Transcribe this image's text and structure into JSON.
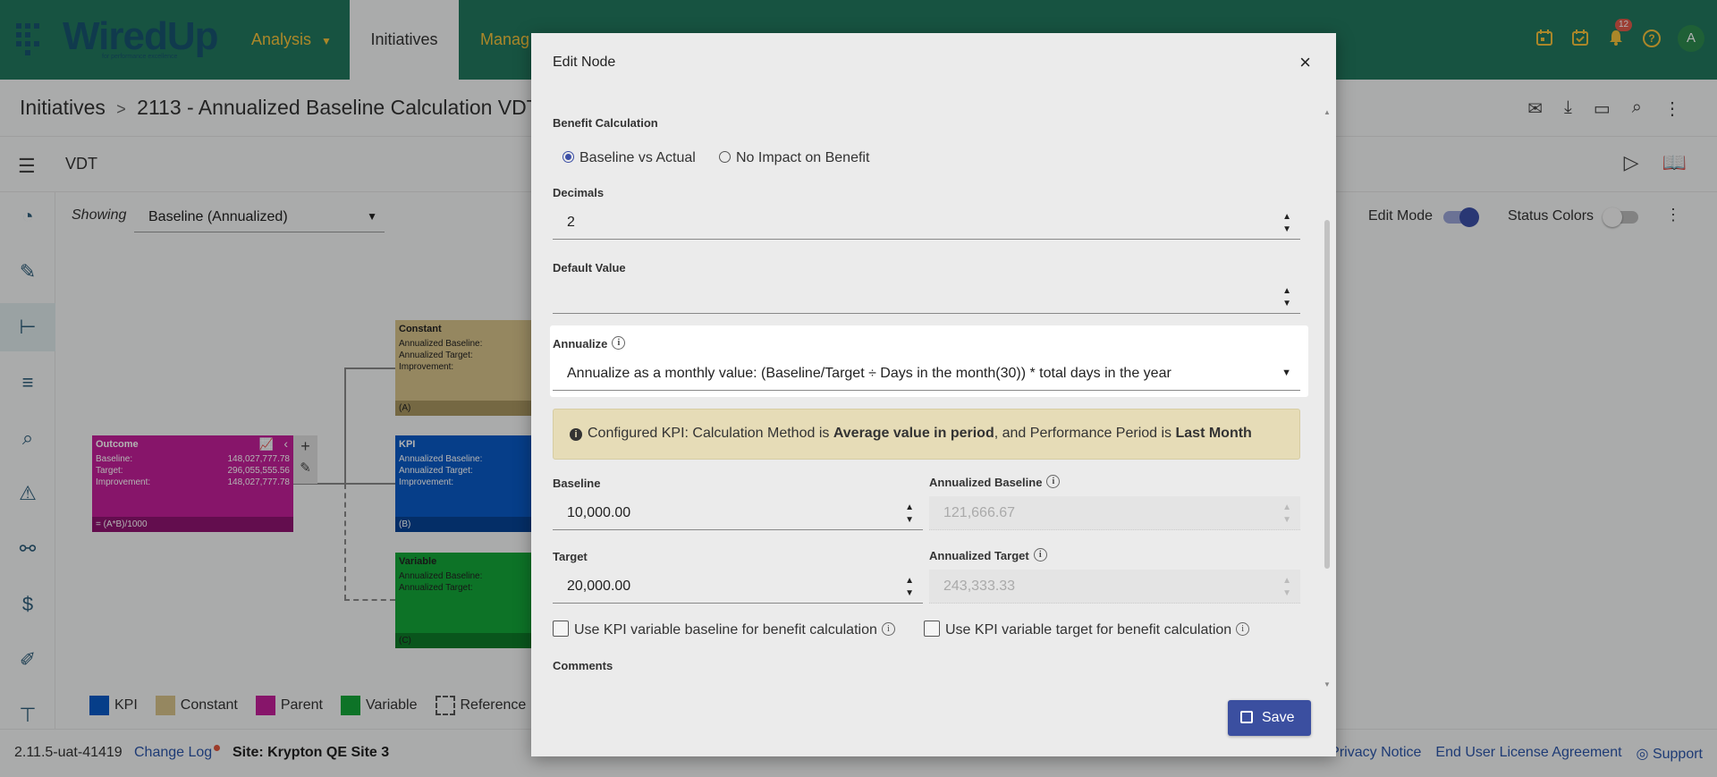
{
  "header": {
    "logo_text": "WiredUp",
    "logo_tagline": "for performance excellence",
    "nav": [
      {
        "label": "Analysis"
      },
      {
        "label": "Initiatives"
      },
      {
        "label": "Manag"
      }
    ],
    "notification_count": "12",
    "avatar_initial": "A"
  },
  "breadcrumb": {
    "root": "Initiatives",
    "separator": ">",
    "current": "2113 - Annualized Baseline Calculation VDT"
  },
  "toolbar": {
    "title": "VDT"
  },
  "canvas": {
    "showing_label": "Showing",
    "showing_value": "Baseline (Annualized)",
    "edit_mode_label": "Edit Mode",
    "edit_mode_on": true,
    "status_colors_label": "Status Colors",
    "status_colors_on": false,
    "nodes": {
      "outcome": {
        "title": "Outcome",
        "baseline_label": "Baseline:",
        "baseline_value": "148,027,777.78",
        "target_label": "Target:",
        "target_value": "296,055,555.56",
        "improvement_label": "Improvement:",
        "improvement_value": "148,027,777.78",
        "formula": "= (A*B)/1000"
      },
      "constant": {
        "title": "Constant",
        "line1": "Annualized Baseline:",
        "line2": "Annualized Target:",
        "line3": "Improvement:",
        "footer": "(A)"
      },
      "kpi": {
        "title": "KPI",
        "line1": "Annualized Baseline:",
        "line2": "Annualized Target:",
        "line3": "Improvement:",
        "footer": "(B)"
      },
      "variable": {
        "title": "Variable",
        "line1": "Annualized Baseline:",
        "line2": "Annualized Target:",
        "footer": "(C)"
      }
    },
    "legend": [
      {
        "label": "KPI",
        "color": "#0a5ac4"
      },
      {
        "label": "Constant",
        "color": "#d6c28a"
      },
      {
        "label": "Parent",
        "color": "#c21f98"
      },
      {
        "label": "Variable",
        "color": "#13a538"
      },
      {
        "label": "Reference",
        "color": "none"
      }
    ]
  },
  "footer": {
    "version": "2.11.5-uat-41419",
    "change_log": "Change Log",
    "site": "Site: Krypton QE Site 3",
    "links": [
      "Privacy Notice",
      "End User License Agreement",
      "Support"
    ]
  },
  "modal": {
    "title": "Edit Node",
    "close": "×",
    "benefit_calculation_label": "Benefit Calculation",
    "radio_baseline_vs_actual": "Baseline vs Actual",
    "radio_no_impact": "No Impact on Benefit",
    "selected_radio": "Baseline vs Actual",
    "decimals_label": "Decimals",
    "decimals_value": "2",
    "default_value_label": "Default Value",
    "default_value_value": "",
    "annualize_label": "Annualize",
    "annualize_value": "Annualize as a monthly value: (Baseline/Target ÷ Days in the month(30)) * total days in the year",
    "alert_prefix": "Configured KPI: Calculation Method is ",
    "alert_method": "Average value in period",
    "alert_middle": ", and Performance Period is ",
    "alert_period": "Last Month",
    "baseline_label": "Baseline",
    "baseline_value": "10,000.00",
    "annualized_baseline_label": "Annualized Baseline",
    "annualized_baseline_value": "121,666.67",
    "target_label": "Target",
    "target_value": "20,000.00",
    "annualized_target_label": "Annualized Target",
    "annualized_target_value": "243,333.33",
    "use_kpi_baseline": "Use KPI variable baseline for benefit calculation",
    "use_kpi_target": "Use KPI variable target for benefit calculation",
    "comments_label": "Comments",
    "save_label": "Save"
  },
  "colors": {
    "topbar": "#22775e",
    "nav_text": "#f5c23b",
    "primary_button": "#3b4fa0",
    "alert_bg": "#e6dcb7"
  }
}
